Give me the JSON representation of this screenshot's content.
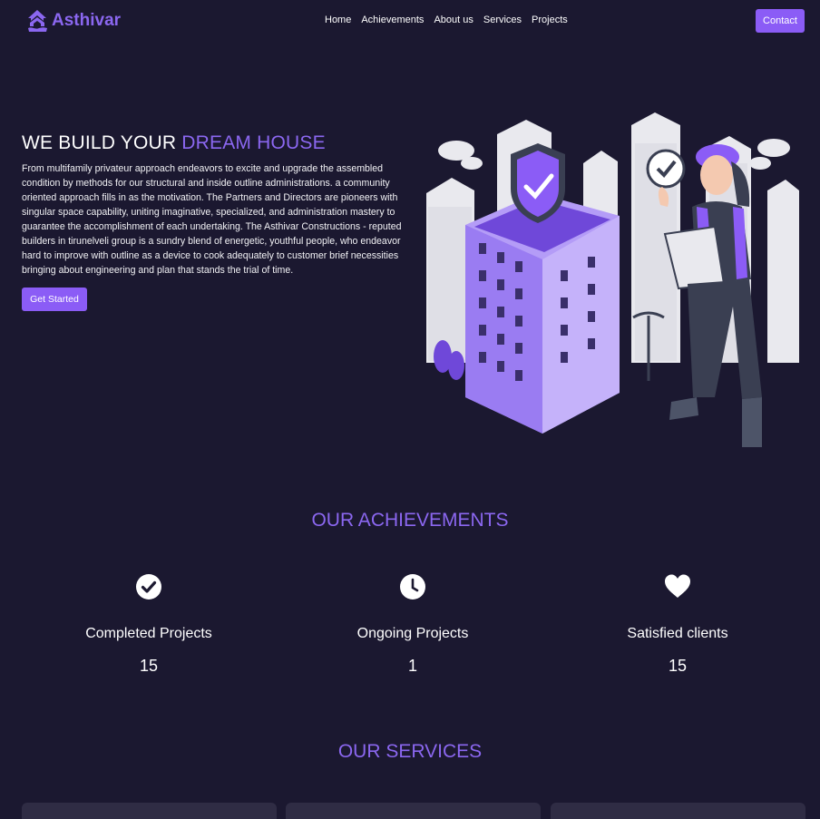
{
  "nav": {
    "brand": "Asthivar",
    "items": [
      "Home",
      "Achievements",
      "About us",
      "Services",
      "Projects"
    ],
    "contact_label": "Contact"
  },
  "hero": {
    "title_plain": "WE BUILD YOUR ",
    "title_accent": "DREAM HOUSE",
    "description": "From multifamily privateur approach endeavors to excite and upgrade the assembled condition by methods for our structural and inside outline administrations. a community oriented approach fills in as the motivation. The Partners and Directors are pioneers with singular space capability, uniting imaginative, specialized, and administration mastery to guarantee the accomplishment of each undertaking. The Asthivar Constructions - reputed builders in tirunelveli group is a sundry blend of energetic, youthful people, who endeavor hard to improve with outline as a device to cook adequately to customer brief necessities bringing about engineering and plan that stands the trial of time.",
    "cta_label": "Get Started"
  },
  "achievements": {
    "title": "OUR ACHIEVEMENTS",
    "items": [
      {
        "icon": "check-circle-icon",
        "label": "Completed Projects",
        "value": "15"
      },
      {
        "icon": "clock-icon",
        "label": "Ongoing Projects",
        "value": "1"
      },
      {
        "icon": "heart-icon",
        "label": "Satisfied clients",
        "value": "15"
      }
    ]
  },
  "services": {
    "title": "OUR SERVICES"
  },
  "colors": {
    "background": "#1b1830",
    "accent": "#8b5cf6",
    "accent_text": "#8b67f0",
    "card": "#2f2c44"
  }
}
